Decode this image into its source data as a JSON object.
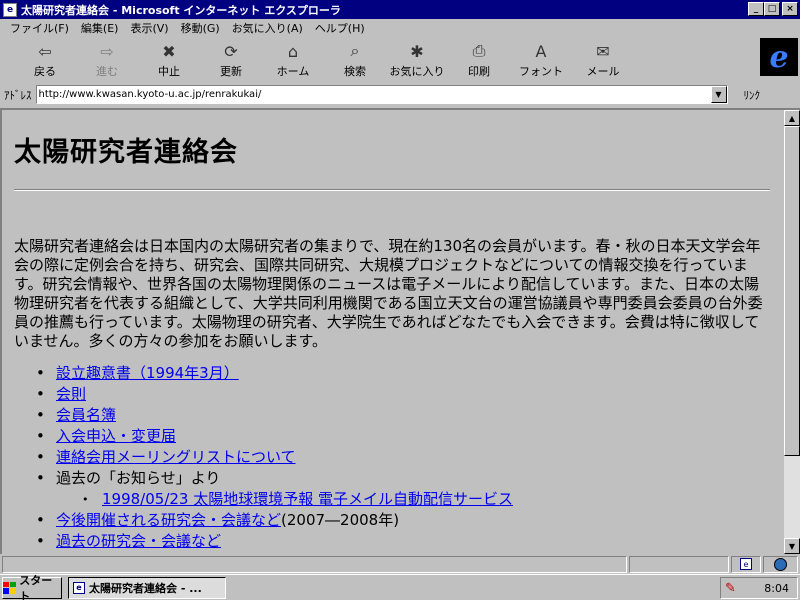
{
  "window": {
    "title": "太陽研究者連絡会 - Microsoft インターネット エクスプローラ",
    "minimize_label": "_",
    "maximize_label": "□",
    "close_label": "×"
  },
  "menu": {
    "items": [
      "ファイル(F)",
      "編集(E)",
      "表示(V)",
      "移動(G)",
      "お気に入り(A)",
      "ヘルプ(H)"
    ]
  },
  "toolbar": {
    "buttons": [
      {
        "label": "戻る",
        "icon": "back-arrow-icon",
        "glyph": "⇦"
      },
      {
        "label": "進む",
        "icon": "forward-arrow-icon",
        "glyph": "⇨"
      },
      {
        "label": "中止",
        "icon": "stop-icon",
        "glyph": "✖"
      },
      {
        "label": "更新",
        "icon": "refresh-icon",
        "glyph": "⟳"
      },
      {
        "label": "ホーム",
        "icon": "home-icon",
        "glyph": "⌂"
      },
      {
        "label": "検索",
        "icon": "search-icon",
        "glyph": "⌕"
      },
      {
        "label": "お気に入り",
        "icon": "favorites-icon",
        "glyph": "✱"
      },
      {
        "label": "印刷",
        "icon": "print-icon",
        "glyph": "⎙"
      },
      {
        "label": "フォント",
        "icon": "font-icon",
        "glyph": "A"
      },
      {
        "label": "メール",
        "icon": "mail-icon",
        "glyph": "✉"
      }
    ],
    "logo_glyph": "e"
  },
  "address": {
    "label": "ｱﾄﾞﾚｽ",
    "url": "http://www.kwasan.kyoto-u.ac.jp/renrakukai/",
    "dropdown_glyph": "▼",
    "links_label": "ﾘﾝｸ"
  },
  "page": {
    "heading": "太陽研究者連絡会",
    "intro": "太陽研究者連絡会は日本国内の太陽研究者の集まりで、現在約130名の会員がいます。春・秋の日本天文学会年会の際に定例会合を持ち、研究会、国際共同研究、大規模プロジェクトなどについての情報交換を行っています。研究会情報や、世界各国の太陽物理関係のニュースは電子メールにより配信しています。また、日本の太陽物理研究者を代表する組織として、大学共同利用機関である国立天文台の運営協議員や専門委員会委員の台外委員の推薦も行っています。太陽物理の研究者、大学院生であればどなたでも入会できます。会費は特に徴収していません。多くの方々の参加をお願いします。",
    "links": {
      "l1": "設立趣意書（1994年3月）",
      "l2": "会則",
      "l3": "会員名簿",
      "l4": "入会申込・変更届",
      "l5": "連絡会用メーリングリストについて",
      "l6_text": "過去の「お知らせ」より",
      "l6_sub": "1998/05/23 太陽地球環境予報 電子メイル自動配信サービス",
      "l7": "今後開催される研究会・会議など",
      "l7_suffix": "(2007―2008年)",
      "l8": "過去の研究会・会議など"
    }
  },
  "scrollbar": {
    "up_glyph": "▲",
    "down_glyph": "▼"
  },
  "taskbar": {
    "start_label": "スタート",
    "task_label": "太陽研究者連絡会 - ...",
    "clock": "8:04",
    "flag_colors": [
      "#ff0000",
      "#00a000",
      "#0000ff",
      "#ffcc00"
    ]
  }
}
